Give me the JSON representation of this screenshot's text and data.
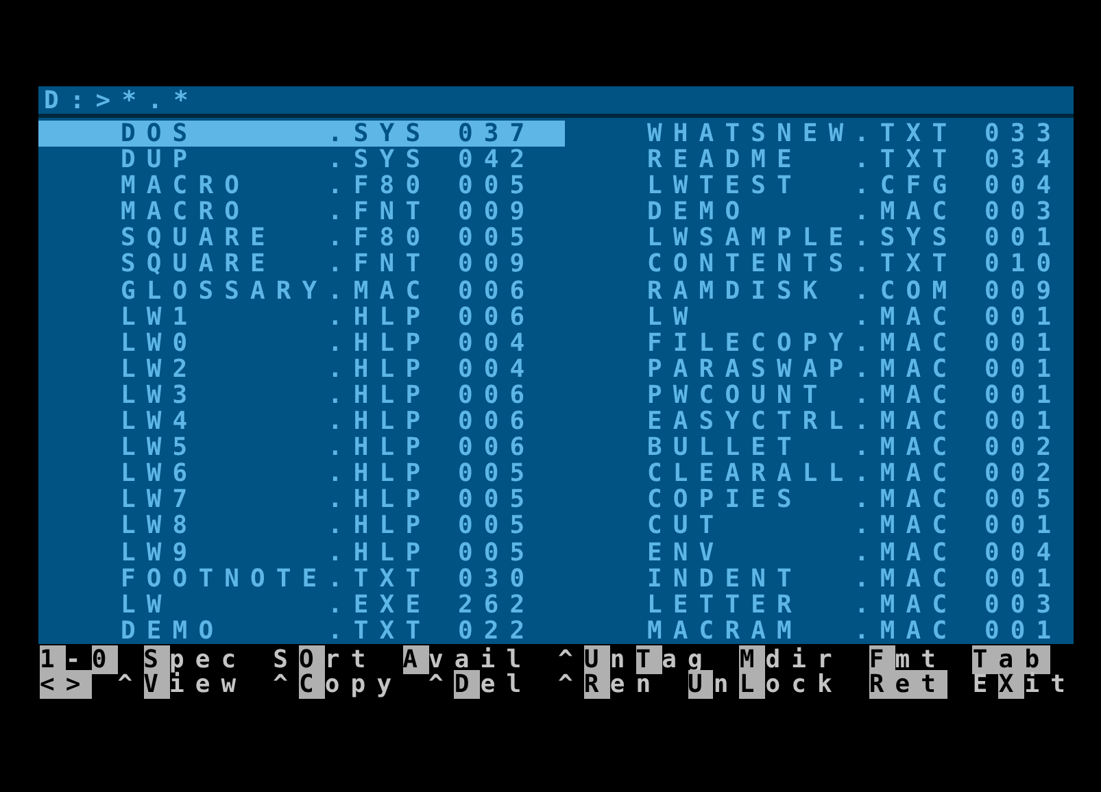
{
  "prompt": "D:>*.*",
  "columns": [
    {
      "files": [
        {
          "name": "DOS",
          "ext": ".SYS",
          "size": "037",
          "selected": true
        },
        {
          "name": "DUP",
          "ext": ".SYS",
          "size": "042",
          "selected": false
        },
        {
          "name": "MACRO",
          "ext": ".F80",
          "size": "005",
          "selected": false
        },
        {
          "name": "MACRO",
          "ext": ".FNT",
          "size": "009",
          "selected": false
        },
        {
          "name": "SQUARE",
          "ext": ".F80",
          "size": "005",
          "selected": false
        },
        {
          "name": "SQUARE",
          "ext": ".FNT",
          "size": "009",
          "selected": false
        },
        {
          "name": "GLOSSARY",
          "ext": ".MAC",
          "size": "006",
          "selected": false
        },
        {
          "name": "LW1",
          "ext": ".HLP",
          "size": "006",
          "selected": false
        },
        {
          "name": "LW0",
          "ext": ".HLP",
          "size": "004",
          "selected": false
        },
        {
          "name": "LW2",
          "ext": ".HLP",
          "size": "004",
          "selected": false
        },
        {
          "name": "LW3",
          "ext": ".HLP",
          "size": "006",
          "selected": false
        },
        {
          "name": "LW4",
          "ext": ".HLP",
          "size": "006",
          "selected": false
        },
        {
          "name": "LW5",
          "ext": ".HLP",
          "size": "006",
          "selected": false
        },
        {
          "name": "LW6",
          "ext": ".HLP",
          "size": "005",
          "selected": false
        },
        {
          "name": "LW7",
          "ext": ".HLP",
          "size": "005",
          "selected": false
        },
        {
          "name": "LW8",
          "ext": ".HLP",
          "size": "005",
          "selected": false
        },
        {
          "name": "LW9",
          "ext": ".HLP",
          "size": "005",
          "selected": false
        },
        {
          "name": "FOOTNOTE",
          "ext": ".TXT",
          "size": "030",
          "selected": false
        },
        {
          "name": "LW",
          "ext": ".EXE",
          "size": "262",
          "selected": false
        },
        {
          "name": "DEMO",
          "ext": ".TXT",
          "size": "022",
          "selected": false
        }
      ]
    },
    {
      "files": [
        {
          "name": "WHATSNEW",
          "ext": ".TXT",
          "size": "033",
          "selected": false
        },
        {
          "name": "README",
          "ext": ".TXT",
          "size": "034",
          "selected": false
        },
        {
          "name": "LWTEST",
          "ext": ".CFG",
          "size": "004",
          "selected": false
        },
        {
          "name": "DEMO",
          "ext": ".MAC",
          "size": "003",
          "selected": false
        },
        {
          "name": "LWSAMPLE",
          "ext": ".SYS",
          "size": "001",
          "selected": false
        },
        {
          "name": "CONTENTS",
          "ext": ".TXT",
          "size": "010",
          "selected": false
        },
        {
          "name": "RAMDISK",
          "ext": ".COM",
          "size": "009",
          "selected": false
        },
        {
          "name": "LW",
          "ext": ".MAC",
          "size": "001",
          "selected": false
        },
        {
          "name": "FILECOPY",
          "ext": ".MAC",
          "size": "001",
          "selected": false
        },
        {
          "name": "PARASWAP",
          "ext": ".MAC",
          "size": "001",
          "selected": false
        },
        {
          "name": "PWCOUNT",
          "ext": ".MAC",
          "size": "001",
          "selected": false
        },
        {
          "name": "EASYCTRL",
          "ext": ".MAC",
          "size": "001",
          "selected": false
        },
        {
          "name": "BULLET",
          "ext": ".MAC",
          "size": "002",
          "selected": false
        },
        {
          "name": "CLEARALL",
          "ext": ".MAC",
          "size": "002",
          "selected": false
        },
        {
          "name": "COPIES",
          "ext": ".MAC",
          "size": "005",
          "selected": false
        },
        {
          "name": "CUT",
          "ext": ".MAC",
          "size": "001",
          "selected": false
        },
        {
          "name": "ENV",
          "ext": ".MAC",
          "size": "004",
          "selected": false
        },
        {
          "name": "INDENT",
          "ext": ".MAC",
          "size": "001",
          "selected": false
        },
        {
          "name": "LETTER",
          "ext": ".MAC",
          "size": "003",
          "selected": false
        },
        {
          "name": "MACRAM",
          "ext": ".MAC",
          "size": "001",
          "selected": false
        }
      ]
    }
  ],
  "key_hints": [
    [
      "**1**-**0**",
      "**S**pec",
      "S**O**rt",
      "**A**vail",
      "^**U**n**T**ag",
      "**M**dir",
      "**F**mt",
      "**Tab**"
    ],
    [
      "**<>**",
      "^**V**iew",
      "^**C**opy",
      "^**D**el",
      "^**R**en",
      "**U**n**L**ock",
      "**Ret**",
      "E**X**it"
    ]
  ]
}
